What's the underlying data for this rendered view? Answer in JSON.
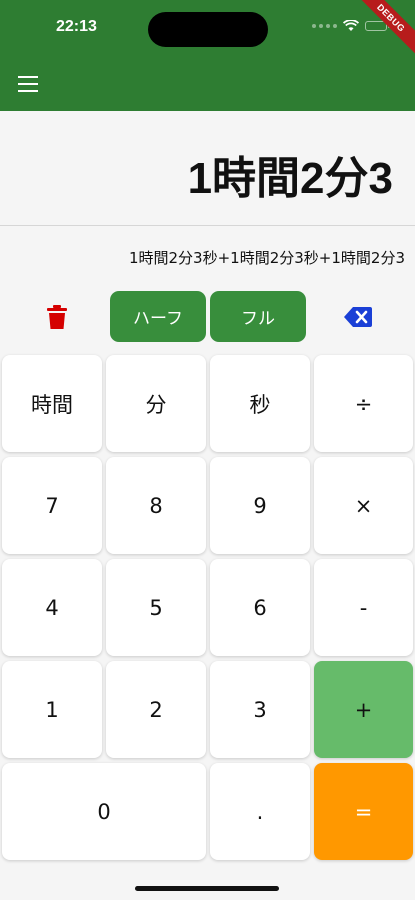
{
  "status_bar": {
    "time": "22:13"
  },
  "debug_banner": "DEBUG",
  "display": {
    "result": "1時間2分3",
    "expression": "1時間2分3秒+1時間2分3秒+1時間2分3"
  },
  "controls": {
    "half_label": "ハーフ",
    "full_label": "フル"
  },
  "colors": {
    "appbar": "#2e7d32",
    "mode_button": "#388e3c",
    "plus_key": "#66bb6a",
    "equals_key": "#ff9800",
    "trash_icon": "#d50000",
    "backspace_icon": "#1a3fd6"
  },
  "keypad": {
    "hour": "時間",
    "minute": "分",
    "second": "秒",
    "divide": "÷",
    "seven": "7",
    "eight": "8",
    "nine": "9",
    "multiply": "×",
    "four": "4",
    "five": "5",
    "six": "6",
    "minus": "-",
    "one": "1",
    "two": "2",
    "three": "3",
    "plus": "+",
    "zero": "0",
    "dot": ".",
    "equals": "="
  }
}
